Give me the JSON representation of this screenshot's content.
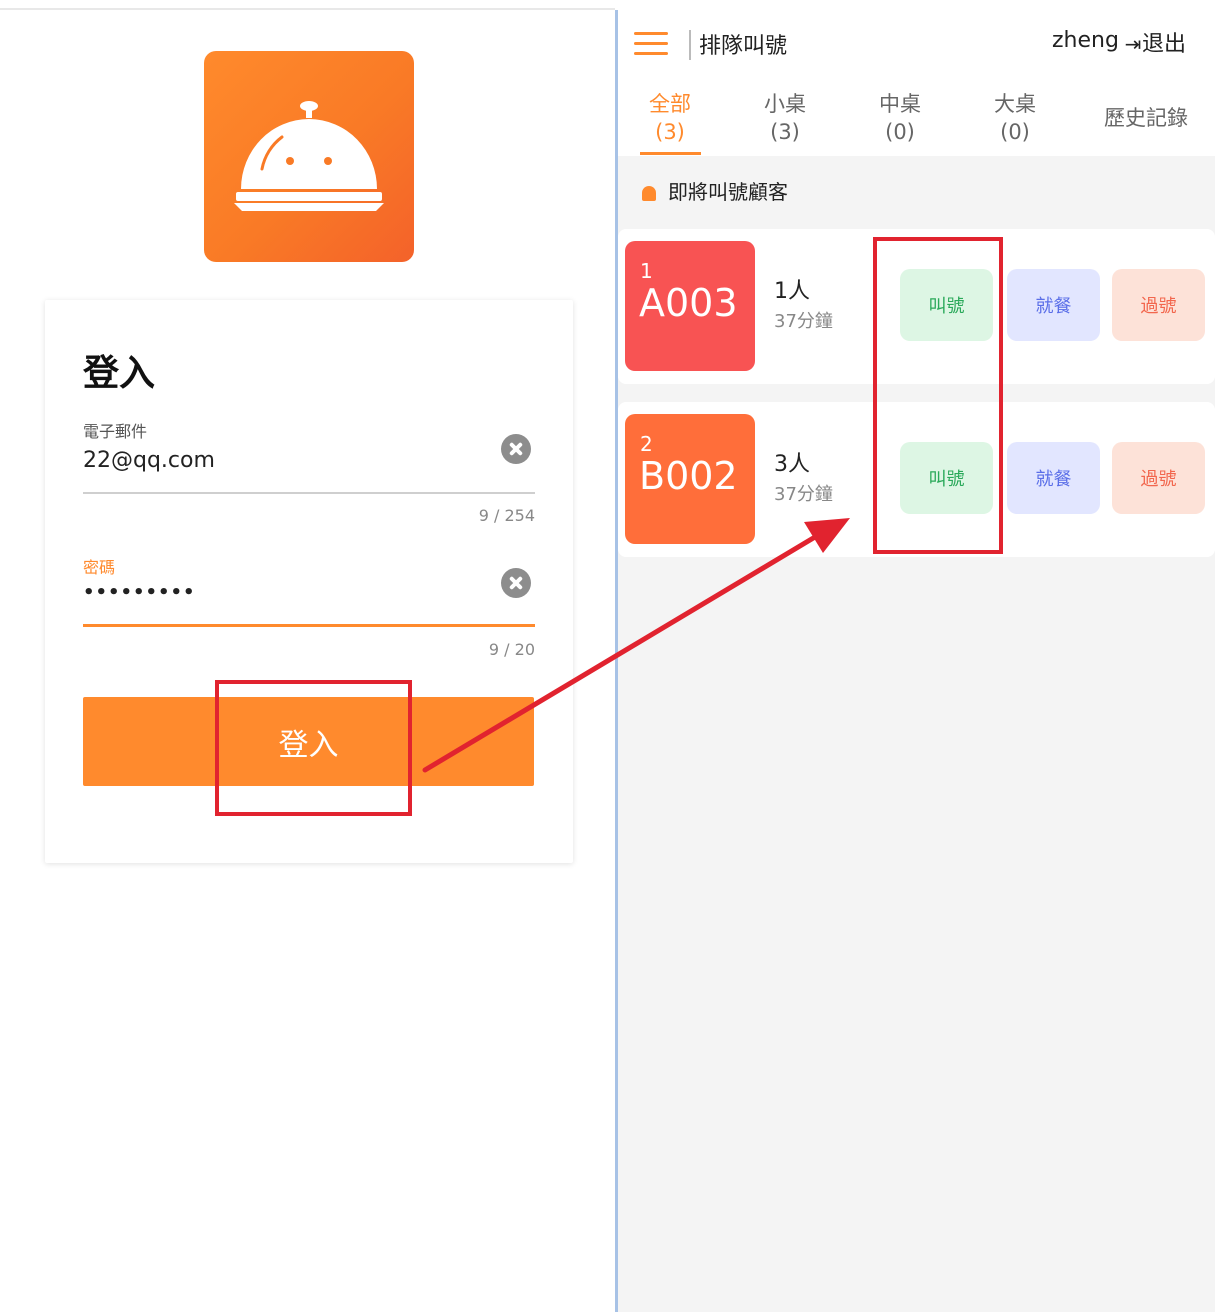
{
  "login": {
    "title": "登入",
    "email_label": "電子郵件",
    "email_value": "22@qq.com",
    "email_counter": "9 / 254",
    "password_label": "密碼",
    "password_value": "•••••••••",
    "password_counter": "9 / 20",
    "submit_label": "登入"
  },
  "queue_app": {
    "title": "排隊叫號",
    "user": "zheng",
    "logout_label": "退出",
    "tabs": [
      {
        "label": "全部",
        "count": "(3)"
      },
      {
        "label": "小桌",
        "count": "(3)"
      },
      {
        "label": "中桌",
        "count": "(0)"
      },
      {
        "label": "大桌",
        "count": "(0)"
      },
      {
        "label": "歷史記錄",
        "count": ""
      }
    ],
    "section_title": "即將叫號顧客",
    "customers": [
      {
        "position": "1",
        "code": "A003",
        "party": "1人",
        "wait": "37分鐘",
        "color": "#f85353"
      },
      {
        "position": "2",
        "code": "B002",
        "party": "3人",
        "wait": "37分鐘",
        "color": "#ff6e3a"
      }
    ],
    "actions": {
      "call": "叫號",
      "seat": "就餐",
      "skip": "過號"
    }
  },
  "colors": {
    "accent": "#ff8a2d",
    "annotation": "#e1232f",
    "divider": "#a7c2e6"
  }
}
